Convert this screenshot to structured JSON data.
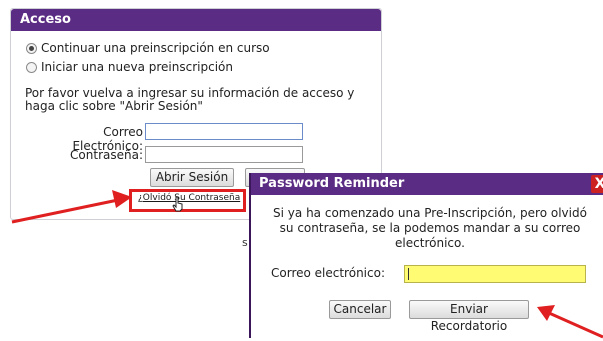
{
  "login": {
    "title": "Acceso",
    "options": [
      {
        "label": "Continuar una preinscripción en curso",
        "selected": true
      },
      {
        "label": "Iniciar una nueva preinscripción",
        "selected": false
      }
    ],
    "instructions": "Por favor vuelva a ingresar su información de acceso y haga clic sobre \"Abrir Sesión\"",
    "email_label": "Correo Electrónico:",
    "email_value": "",
    "password_label": "Contraseña:",
    "password_value": "",
    "login_button": "Abrir Sesión",
    "forgot_link": "¿Olvidó Su Contraseña"
  },
  "partial_text": "s",
  "reminder": {
    "title": "Password Reminder",
    "close": "X",
    "message": "Si ya ha comenzado una Pre-Inscripción, pero olvidó su contraseña, se la podemos mandar a su correo electrónico.",
    "email_label": "Correo electrónico:",
    "email_value": "",
    "cancel_button": "Cancelar",
    "send_button": "Enviar Recordatorio"
  },
  "colors": {
    "header": "#5b2c83",
    "highlight": "#e02020",
    "field_highlight": "#fffb73"
  }
}
